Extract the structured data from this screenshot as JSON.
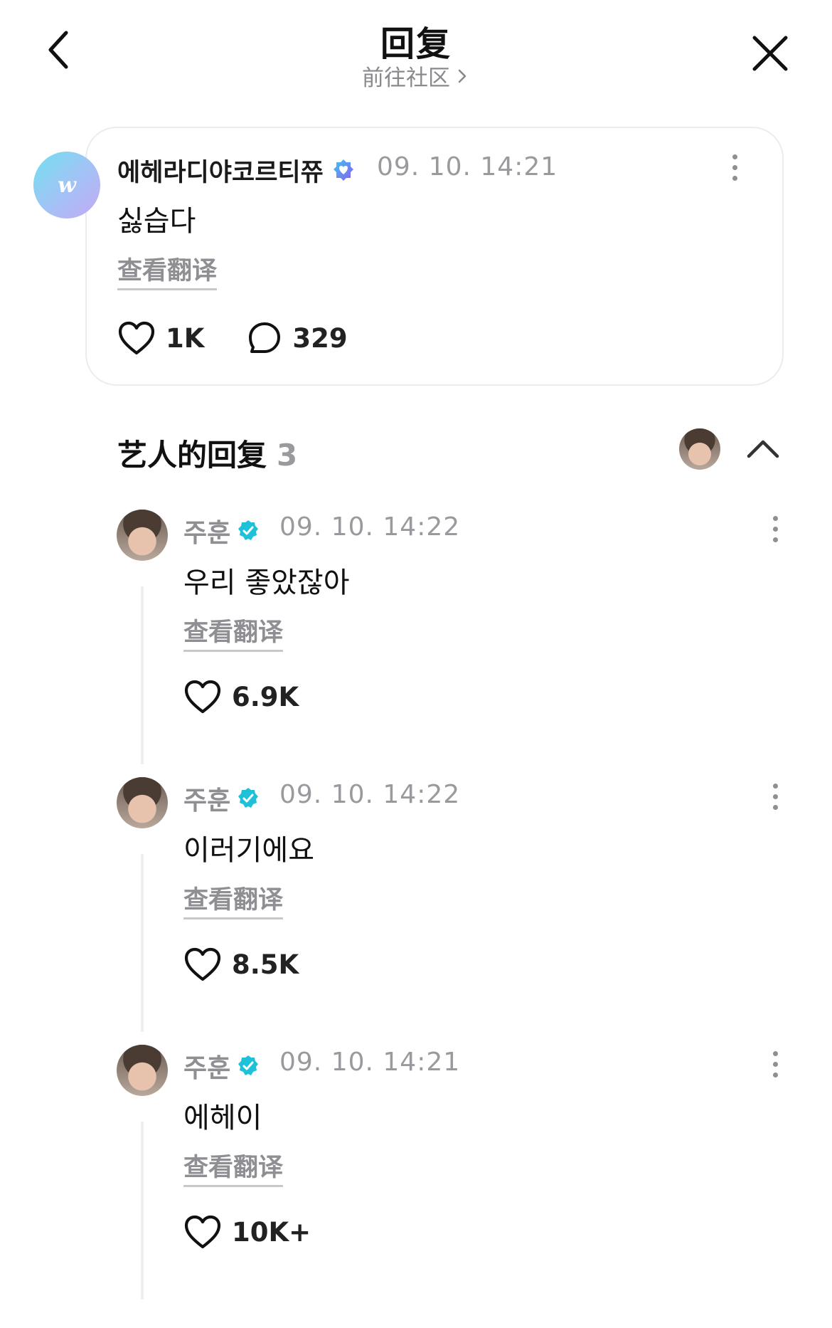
{
  "header": {
    "title": "回复",
    "subtitle": "前往社区"
  },
  "post": {
    "author": "에헤라디야코르티쮸",
    "time": "09. 10. 14:21",
    "body": "싫습다",
    "translate": "查看翻译",
    "likes": "1K",
    "comments": "329"
  },
  "artist_replies": {
    "title": "艺人的回复",
    "count": "3",
    "items": [
      {
        "name": "주훈",
        "time": "09. 10. 14:22",
        "body": "우리 좋았잖아",
        "translate": "查看翻译",
        "likes": "6.9K"
      },
      {
        "name": "주훈",
        "time": "09. 10. 14:22",
        "body": "이러기에요",
        "translate": "查看翻译",
        "likes": "8.5K"
      },
      {
        "name": "주훈",
        "time": "09. 10. 14:21",
        "body": "에헤이",
        "translate": "查看翻译",
        "likes": "10K+"
      }
    ]
  },
  "colors": {
    "verified_artist": "#1fc1d8",
    "verified_fan": "#6e7cf0",
    "muted": "#8e8e93"
  }
}
